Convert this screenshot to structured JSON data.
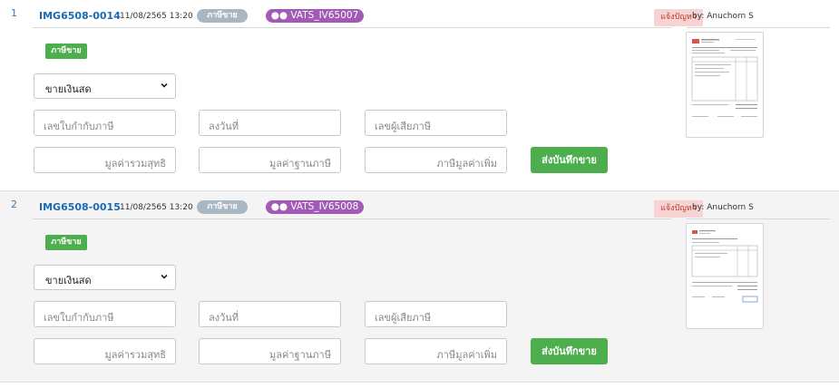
{
  "records": [
    {
      "index": "1",
      "doc_id": "IMG6508-0014",
      "timestamp": "11/08/2565 13:20",
      "type_badge": "ภาษีขาย",
      "ref_badge": "●● VATS_IV65007",
      "report_button": "แจ้งปัญหา",
      "uploaded_by": "by: Anuchorn S",
      "category_tag": "ภาษีขาย",
      "payment_select": "ขายเงินสด",
      "fields": {
        "invoice_no_placeholder": "เลขใบกำกับภาษี",
        "date_placeholder": "ลงวันที่",
        "taxpayer_id_placeholder": "เลขผู้เสียภาษี",
        "net_total_placeholder": "มูลค่ารวมสุทธิ",
        "tax_base_placeholder": "มูลค่าฐานภาษี",
        "vat_placeholder": "ภาษีมูลค่าเพิ่ม"
      },
      "submit_button": "ส่งบันทึกขาย"
    },
    {
      "index": "2",
      "doc_id": "IMG6508-0015",
      "timestamp": "11/08/2565 13:20",
      "type_badge": "ภาษีขาย",
      "ref_badge": "●● VATS_IV65008",
      "report_button": "แจ้งปัญหา",
      "uploaded_by": "by: Anuchorn S",
      "category_tag": "ภาษีขาย",
      "payment_select": "ขายเงินสด",
      "fields": {
        "invoice_no_placeholder": "เลขใบกำกับภาษี",
        "date_placeholder": "ลงวันที่",
        "taxpayer_id_placeholder": "เลขผู้เสียภาษี",
        "net_total_placeholder": "มูลค่ารวมสุทธิ",
        "tax_base_placeholder": "มูลค่าฐานภาษี",
        "vat_placeholder": "ภาษีมูลค่าเพิ่ม"
      },
      "submit_button": "ส่งบันทึกขาย"
    }
  ],
  "colors": {
    "link": "#1a6bb3",
    "green": "#4cae4c",
    "purple": "#a25ab7",
    "gray_badge": "#a9b7c3",
    "report_bg": "#f7d3d3",
    "report_text": "#c0392b"
  }
}
